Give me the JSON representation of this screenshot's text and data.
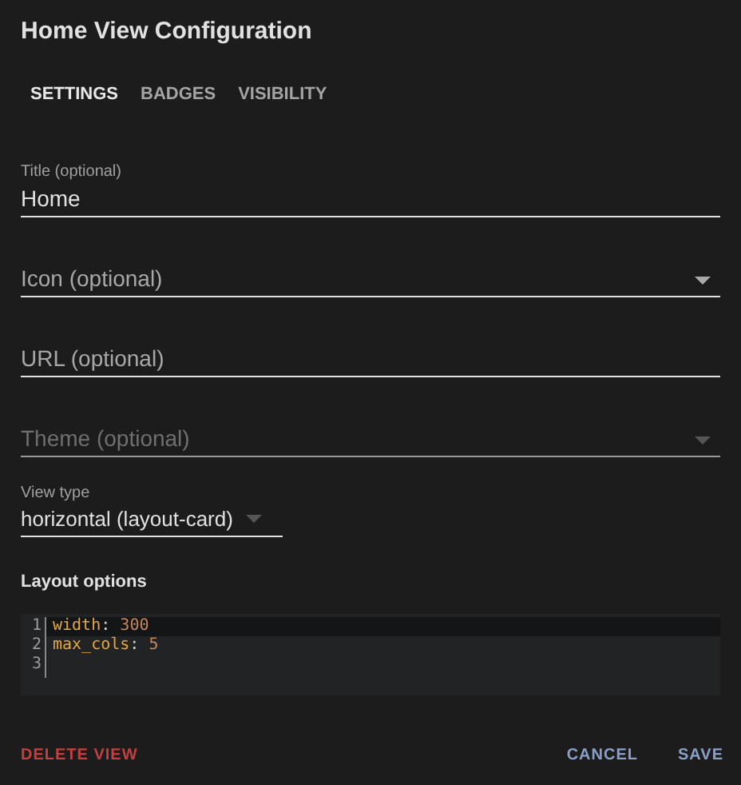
{
  "dialog": {
    "title": "Home View Configuration"
  },
  "tabs": [
    {
      "label": "SETTINGS",
      "selected": true
    },
    {
      "label": "BADGES",
      "selected": false
    },
    {
      "label": "VISIBILITY",
      "selected": false
    }
  ],
  "fields": [
    {
      "kind": "text",
      "label": "Title (optional)",
      "value": "Home",
      "disabled": false
    },
    {
      "kind": "dropdown",
      "placeholder": "Icon (optional)",
      "disabled": false
    },
    {
      "kind": "text",
      "placeholder": "URL (optional)",
      "disabled": false
    },
    {
      "kind": "dropdown",
      "placeholder": "Theme (optional)",
      "disabled": true
    }
  ],
  "view_type": {
    "label": "View type",
    "value": "horizontal (layout-card)"
  },
  "layout_options": {
    "heading": "Layout options",
    "lines": [
      {
        "number": "1",
        "key": "width",
        "sep": ":",
        "value": "300",
        "active": true
      },
      {
        "number": "2",
        "key": "max_cols",
        "sep": ":",
        "value": "5",
        "active": false
      },
      {
        "number": "3",
        "active": false
      }
    ]
  },
  "actions": {
    "delete": "DELETE VIEW",
    "cancel": "CANCEL",
    "save": "SAVE"
  }
}
